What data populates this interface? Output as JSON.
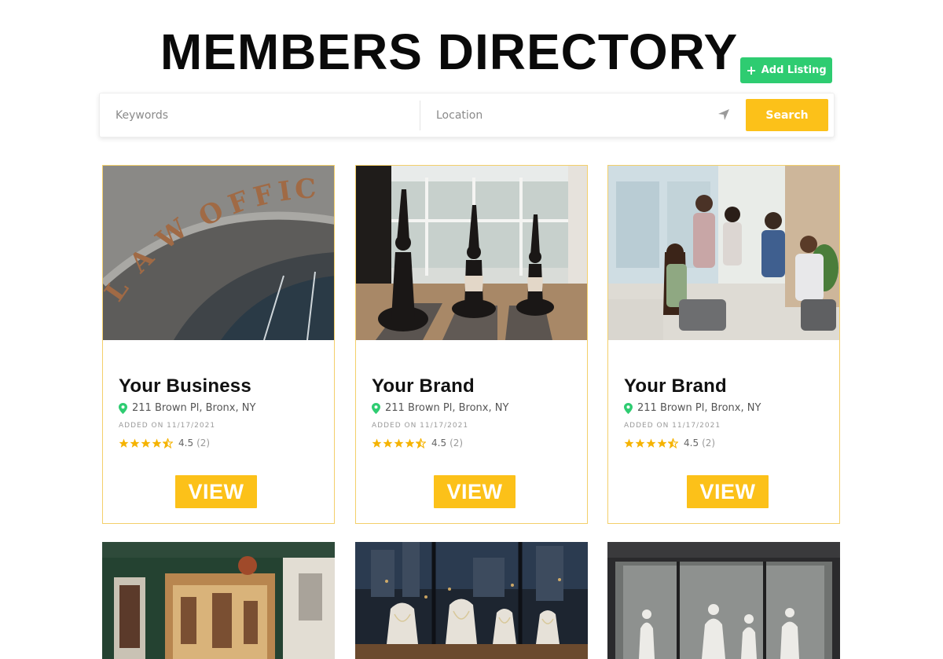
{
  "header": {
    "title": "MEMBERS DIRECTORY",
    "add_listing_label": "Add Listing"
  },
  "search": {
    "keywords_placeholder": "Keywords",
    "location_placeholder": "Location",
    "button_label": "Search"
  },
  "colors": {
    "accent_yellow": "#fcc119",
    "add_green": "#2ecc71",
    "pin_green": "#2ecc71",
    "star_yellow": "#f5b301"
  },
  "listings": [
    {
      "title": "Your Business",
      "address": "211 Brown Pl, Bronx, NY",
      "added": "ADDED ON 11/17/2021",
      "rating": "4.5",
      "rating_count": "(2)",
      "stars": 4.5,
      "view_label": "VIEW",
      "image": "law-office-photo"
    },
    {
      "title": "Your Brand",
      "address": "211 Brown Pl, Bronx, NY",
      "added": "ADDED ON 11/17/2021",
      "rating": "4.5",
      "rating_count": "(2)",
      "stars": 4.5,
      "view_label": "VIEW",
      "image": "yoga-studio-photo"
    },
    {
      "title": "Your Brand",
      "address": "211 Brown Pl, Bronx, NY",
      "added": "ADDED ON 11/17/2021",
      "rating": "4.5",
      "rating_count": "(2)",
      "stars": 4.5,
      "view_label": "VIEW",
      "image": "office-meeting-photo"
    }
  ],
  "more_listings": [
    {
      "image": "storefront-photo"
    },
    {
      "image": "jewelry-display-photo"
    },
    {
      "image": "fashion-boutique-photo"
    }
  ]
}
